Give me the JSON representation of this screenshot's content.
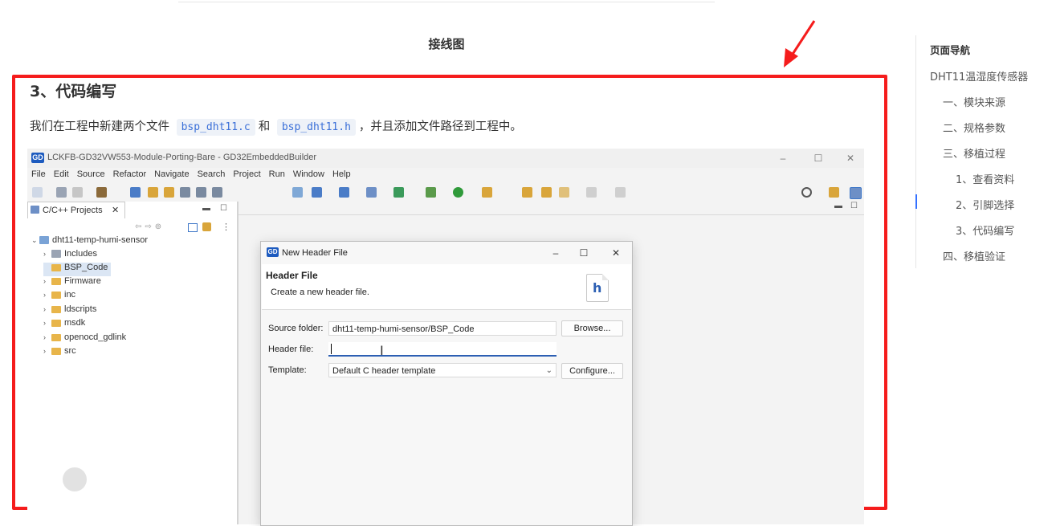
{
  "caption": "接线图",
  "section": {
    "title": "3、代码编写",
    "para_before": "我们在工程中新建两个文件",
    "file1": "bsp_dht11.c",
    "para_mid": "和",
    "file2": "bsp_dht11.h",
    "para_after": "，并且添加文件路径到工程中。"
  },
  "ide": {
    "badge": "GD",
    "title": "LCKFB-GD32VW553-Module-Porting-Bare - GD32EmbeddedBuilder",
    "window_controls": [
      "–",
      "☐",
      "✕"
    ],
    "menu": [
      "File",
      "Edit",
      "Source",
      "Refactor",
      "Navigate",
      "Search",
      "Project",
      "Run",
      "Window",
      "Help"
    ],
    "projects_tab": "C/C++ Projects",
    "tree": [
      {
        "label": "dht11-temp-humi-sensor",
        "expanded": true,
        "level": 0
      },
      {
        "label": "Includes",
        "level": 1
      },
      {
        "label": "BSP_Code",
        "level": 1,
        "selected": true
      },
      {
        "label": "Firmware",
        "level": 1
      },
      {
        "label": "inc",
        "level": 1
      },
      {
        "label": "ldscripts",
        "level": 1
      },
      {
        "label": "msdk",
        "level": 1
      },
      {
        "label": "openocd_gdlink",
        "level": 1
      },
      {
        "label": "src",
        "level": 1
      }
    ]
  },
  "dialog": {
    "badge": "GD",
    "window_title": "New Header File",
    "heading": "Header File",
    "description": "Create a new header file.",
    "icon_letter": "h",
    "source_folder_label": "Source folder:",
    "source_folder_value": "dht11-temp-humi-sensor/BSP_Code",
    "browse_button": "Browse...",
    "header_file_label": "Header file:",
    "header_file_value": "",
    "template_label": "Template:",
    "template_value": "Default C header template",
    "configure_button": "Configure..."
  },
  "nav": {
    "title": "页面导航",
    "items": [
      {
        "label": "DHT11温湿度传感器",
        "level": 0
      },
      {
        "label": "一、模块来源",
        "level": 1
      },
      {
        "label": "二、规格参数",
        "level": 1
      },
      {
        "label": "三、移植过程",
        "level": 1
      },
      {
        "label": "1、查看资料",
        "level": 2
      },
      {
        "label": "2、引脚选择",
        "level": 2,
        "active": true
      },
      {
        "label": "3、代码编写",
        "level": 2
      },
      {
        "label": "四、移植验证",
        "level": 1
      }
    ]
  },
  "colors": {
    "highlight_border": "#f51c1c",
    "accent": "#3370ff",
    "gd_badge": "#1d5bbf"
  }
}
